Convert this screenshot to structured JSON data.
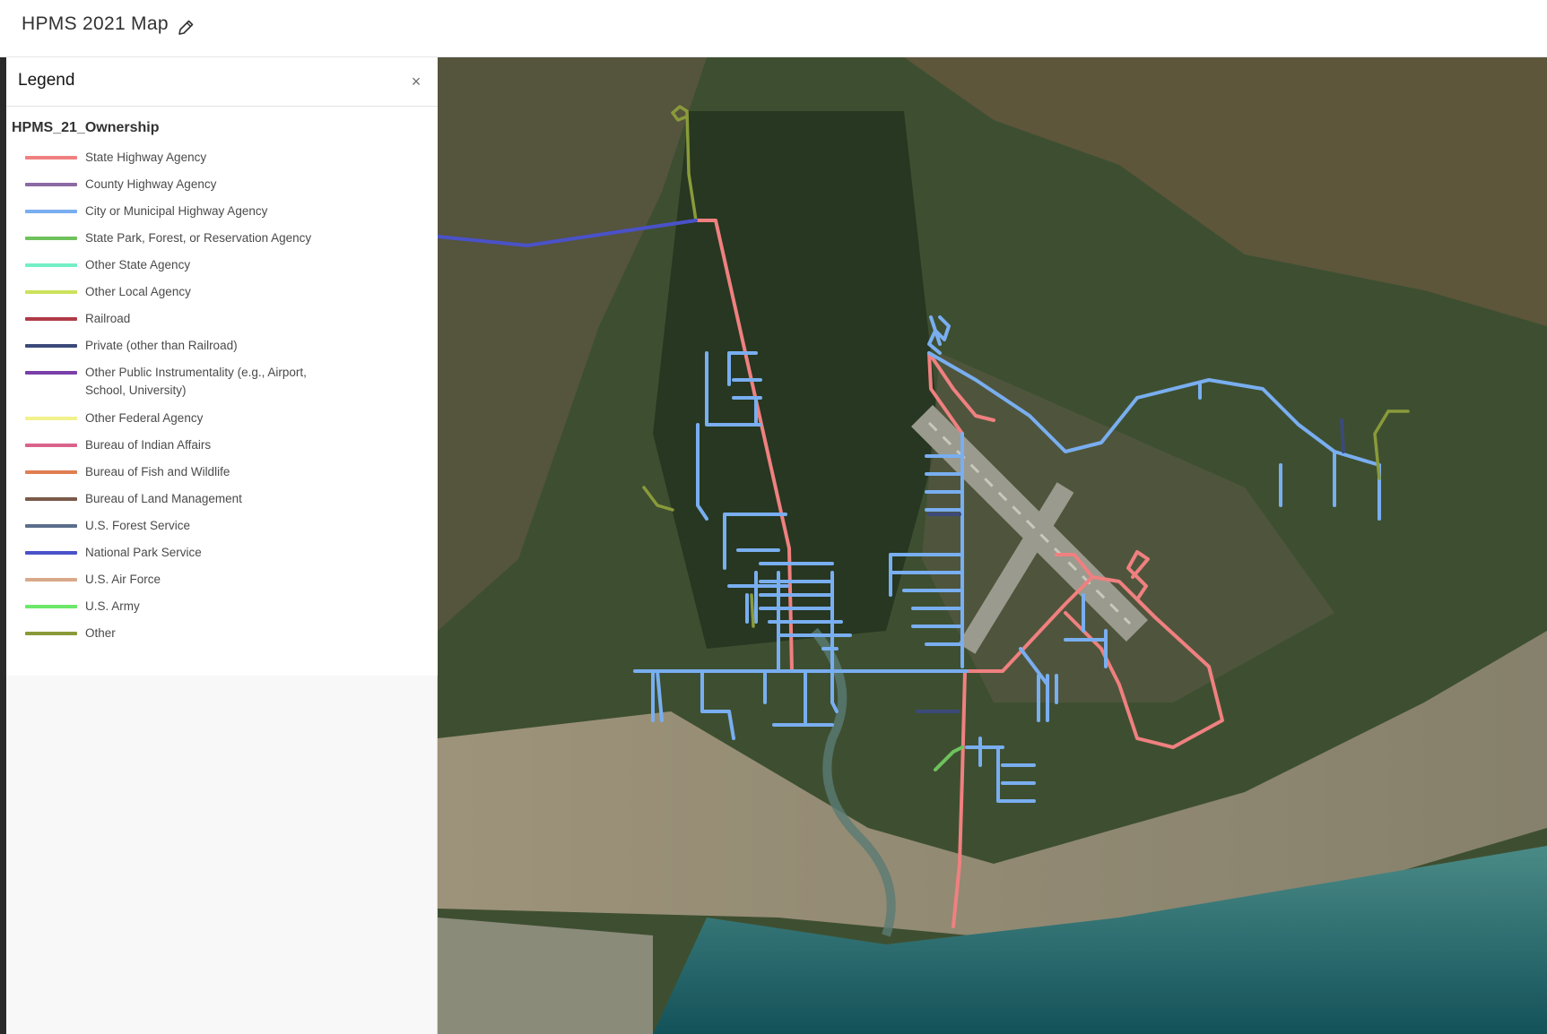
{
  "header": {
    "title": "HPMS 2021 Map",
    "edit_icon": "pencil-icon"
  },
  "legend_panel": {
    "title": "Legend",
    "close_icon": "close-icon",
    "close_glyph": "×",
    "layer_name": "HPMS_21_Ownership",
    "items": [
      {
        "label": "State Highway Agency",
        "color": "#f08080"
      },
      {
        "label": "County Highway Agency",
        "color": "#8c6aa3"
      },
      {
        "label": "City or Municipal Highway Agency",
        "color": "#79aef0"
      },
      {
        "label": "State Park, Forest, or Reservation Agency",
        "color": "#6fc25d"
      },
      {
        "label": "Other State Agency",
        "color": "#73efc4"
      },
      {
        "label": "Other Local Agency",
        "color": "#cbe25a"
      },
      {
        "label": "Railroad",
        "color": "#b03a47"
      },
      {
        "label": "Private (other than Railroad)",
        "color": "#3b4a7a"
      },
      {
        "label": "Other Public Instrumentality (e.g., Airport, School, University)",
        "color": "#7a3fa8"
      },
      {
        "label": "Other Federal Agency",
        "color": "#f2f28c"
      },
      {
        "label": "Bureau of Indian Affairs",
        "color": "#d9638b"
      },
      {
        "label": "Bureau of Fish and Wildlife",
        "color": "#e07e52"
      },
      {
        "label": "Bureau of Land Management",
        "color": "#7a5a4a"
      },
      {
        "label": "U.S. Forest Service",
        "color": "#5a6e8a"
      },
      {
        "label": "National Park Service",
        "color": "#4a52c9"
      },
      {
        "label": "U.S. Air Force",
        "color": "#d9a98a"
      },
      {
        "label": "U.S. Army",
        "color": "#6ce86a"
      },
      {
        "label": "Other",
        "color": "#8a9a3a"
      }
    ]
  }
}
